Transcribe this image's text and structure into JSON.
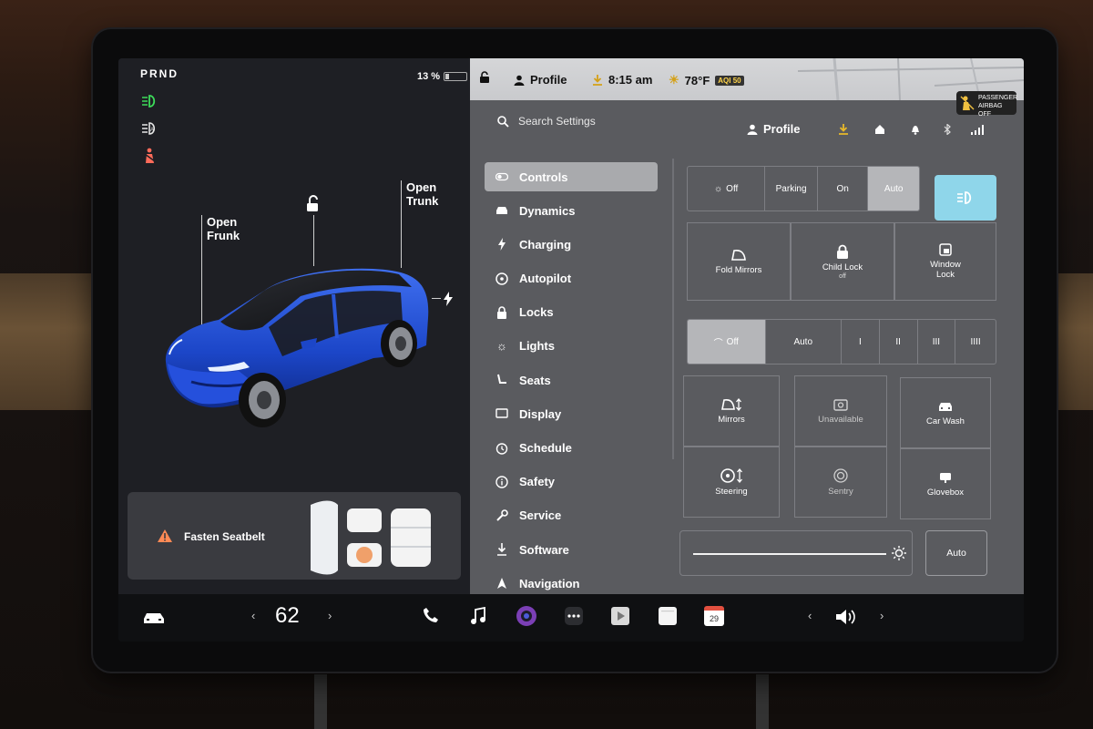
{
  "car_status": {
    "gear": "PRND",
    "battery": "13 %",
    "callouts": {
      "frunk": [
        "Open",
        "Frunk"
      ],
      "trunk": [
        "Open",
        "Trunk"
      ]
    },
    "alert": "Fasten Seatbelt"
  },
  "status_bar": {
    "profile": "Profile",
    "time": "8:15 am",
    "temperature": "78°F",
    "aqi": "AQI 50",
    "airbag": [
      "PASSENGER",
      "AIRBAG OFF"
    ]
  },
  "settings": {
    "search_placeholder": "Search Settings",
    "profile": "Profile",
    "menu": [
      {
        "label": "Controls",
        "icon": "toggle-icon",
        "active": true
      },
      {
        "label": "Dynamics",
        "icon": "car-icon"
      },
      {
        "label": "Charging",
        "icon": "bolt-icon"
      },
      {
        "label": "Autopilot",
        "icon": "steering-wheel-icon"
      },
      {
        "label": "Locks",
        "icon": "lock-icon"
      },
      {
        "label": "Lights",
        "icon": "sun-icon"
      },
      {
        "label": "Seats",
        "icon": "seat-icon"
      },
      {
        "label": "Display",
        "icon": "display-icon"
      },
      {
        "label": "Schedule",
        "icon": "clock-icon"
      },
      {
        "label": "Safety",
        "icon": "info-icon"
      },
      {
        "label": "Service",
        "icon": "wrench-icon"
      },
      {
        "label": "Software",
        "icon": "download-icon"
      },
      {
        "label": "Navigation",
        "icon": "navigation-icon"
      }
    ]
  },
  "controls": {
    "headlights": {
      "off": "Off",
      "parking": "Parking",
      "on": "On",
      "auto": "Auto"
    },
    "fold_mirrors": "Fold Mirrors",
    "child_lock": "Child Lock",
    "child_lock_state": "off",
    "window_lock": [
      "Window",
      "Lock"
    ],
    "wipers": {
      "off": "Off",
      "auto": "Auto",
      "speeds": [
        "I",
        "II",
        "III",
        "IIII"
      ]
    },
    "mirrors": "Mirrors",
    "unavailable": "Unavailable",
    "car_wash": "Car Wash",
    "steering": "Steering",
    "sentry": "Sentry",
    "glovebox": "Glovebox",
    "brightness_auto": "Auto"
  },
  "bottom_bar": {
    "temperature": "62",
    "calendar_day": "29"
  }
}
